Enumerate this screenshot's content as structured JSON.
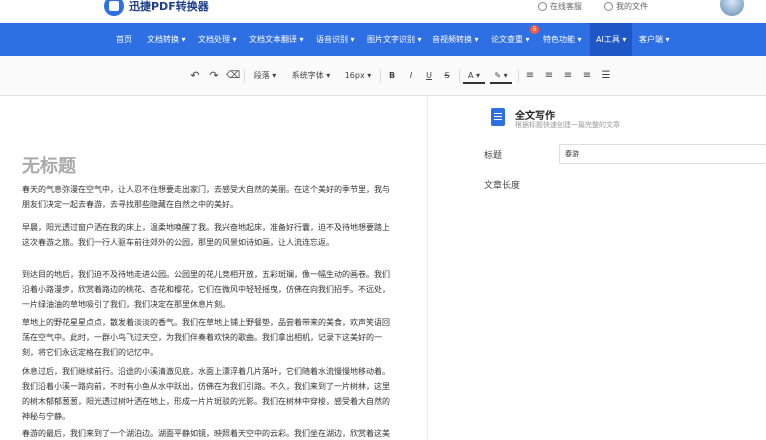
{
  "header": {
    "logo_text": "迅捷PDF转换器",
    "links": [
      {
        "label": "在线客服",
        "icon": "headset-icon"
      },
      {
        "label": "我的文件",
        "icon": "user-icon"
      }
    ]
  },
  "nav": {
    "items": [
      {
        "label": "首页"
      },
      {
        "label": "文档转换 ▾"
      },
      {
        "label": "文档处理 ▾"
      },
      {
        "label": "文档文本翻译 ▾"
      },
      {
        "label": "语音识别 ▾"
      },
      {
        "label": "图片文字识别 ▾"
      },
      {
        "label": "音视频转换 ▾"
      },
      {
        "label": "论文查重 ▾"
      },
      {
        "label": "特色功能 ▾"
      },
      {
        "label": "AI工具 ▾"
      },
      {
        "label": "客户端 ▾"
      }
    ],
    "active_index": 9,
    "badge": "8"
  },
  "toolbar": {
    "undo": "↶",
    "redo": "↷",
    "clear_format": "⌫",
    "paragraph": "段落 ▾",
    "font": "系统字体 ▾",
    "size": "16px ▾",
    "bold": "B",
    "italic": "I",
    "underline": "U",
    "strike": "S",
    "font_color": "A ▾",
    "highlight": "✎ ▾",
    "align_left": "≡",
    "align_center": "≡",
    "align_right": "≡",
    "justify": "≡",
    "indent": "☰"
  },
  "editor": {
    "title": "无标题",
    "paragraphs": [
      "春天的气息弥漫在空气中，让人忍不住想要走出家门，去感受大自然的美丽。在这个美好的季节里，我与朋友们决定一起去春游，去寻找那些隐藏在自然之中的美好。",
      "早晨，阳光透过窗户洒在我的床上，温柔地唤醒了我。我兴奋地起床，准备好行囊，迫不及待地想要踏上这次春游之旅。我们一行人驱车前往郊外的公园，那里的风景如诗如画，让人流连忘返。",
      "到达目的地后，我们迫不及待地走进公园。公园里的花儿竞相开放，五彩斑斓，像一幅生动的画卷。我们沿着小路漫步，欣赏着路边的桃花、杏花和樱花，它们在微风中轻轻摇曳，仿佛在向我们招手。不远处，一片绿油油的草地吸引了我们，我们决定在那里休息片刻。",
      "草地上的野花星星点点，散发着淡淡的香气。我们在草地上铺上野餐垫，品尝着带来的美食，欢声笑语回荡在空气中。此时，一群小鸟飞过天空，为我们伴奏着欢快的歌曲。我们拿出相机，记录下这美好的一刻，将它们永远定格在我们的记忆中。",
      "休息过后，我们继续前行。沿途的小溪清澈见底，水面上漂浮着几片落叶，它们随着水流慢慢地移动着。我们沿着小溪一路向前，不时有小鱼从水中跃出，仿佛在为我们引路。不久，我们来到了一片树林，这里的树木郁郁葱葱，阳光透过树叶洒在地上，形成一片片斑驳的光影。我们在树林中穿梭，感受着大自然的神秘与宁静。",
      "春游的最后，我们来到了一个湖泊边。湖面平静如镜，映照着天空中的云彩。我们坐在湖边，欣赏着这美丽的景色，感受着春天带来的温暖。"
    ]
  },
  "panel": {
    "title": "全文写作",
    "subtitle": "根据标题快速创建一篇完整的文章",
    "topic_label": "标题",
    "topic_value": "春游",
    "length_label": "文章长度"
  }
}
